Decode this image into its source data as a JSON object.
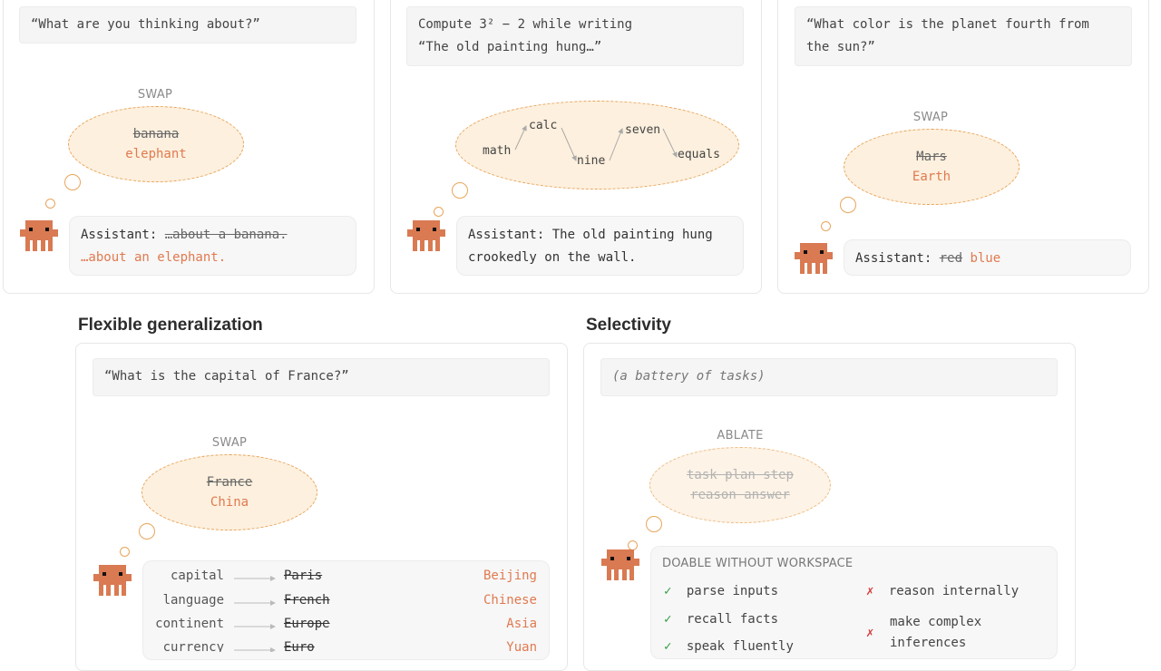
{
  "panel1": {
    "prompt": "“What are you thinking about?”",
    "label": "SWAP",
    "bubble_old": "banana",
    "bubble_new": "elephant",
    "reply_prefix": "Assistant: ",
    "reply_old": "…about a banana.",
    "reply_new": "…about an elephant."
  },
  "panel2": {
    "prompt_line1": "Compute 3² − 2 while writing",
    "prompt_line2": "“The old painting hung…”",
    "chain": [
      "math",
      "calc",
      "nine",
      "seven",
      "equals"
    ],
    "reply_line1": "Assistant: The old painting hung",
    "reply_line2": "crookedly on the wall."
  },
  "panel3": {
    "prompt_line1": "“What color is the planet fourth from",
    "prompt_line2": "the sun?”",
    "label": "SWAP",
    "bubble_old": "Mars",
    "bubble_new": "Earth",
    "reply_prefix": "Assistant: ",
    "reply_old": "red",
    "reply_new": "blue"
  },
  "flexible": {
    "title": "Flexible generalization",
    "prompt": "“What is the capital of France?”",
    "label": "SWAP",
    "bubble_old": "France",
    "bubble_new": "China",
    "rows": [
      {
        "key": "capital",
        "old": "Paris",
        "new": "Beijing"
      },
      {
        "key": "language",
        "old": "French",
        "new": "Chinese"
      },
      {
        "key": "continent",
        "old": "Europe",
        "new": "Asia"
      },
      {
        "key": "currency",
        "old": "Euro",
        "new": "Yuan"
      }
    ]
  },
  "selectivity": {
    "title": "Selectivity",
    "prompt": "(a battery of tasks)",
    "label": "ABLATE",
    "bubble_line1": "task plan step",
    "bubble_line2": "reason answer",
    "box_header": "DOABLE WITHOUT WORKSPACE",
    "can": [
      "parse inputs",
      "recall facts",
      "speak fluently"
    ],
    "cannot_1": "reason internally",
    "cannot_2a": "make complex",
    "cannot_2b": "inferences",
    "check_glyph": "✓",
    "x_glyph": "✗"
  },
  "colors": {
    "accent": "#e07a50",
    "robot": "#d97a52",
    "bubble_fill": "#fdf0de",
    "bubble_border": "#e8a55c",
    "check": "#2e9a3e",
    "cross": "#d43b3b"
  }
}
